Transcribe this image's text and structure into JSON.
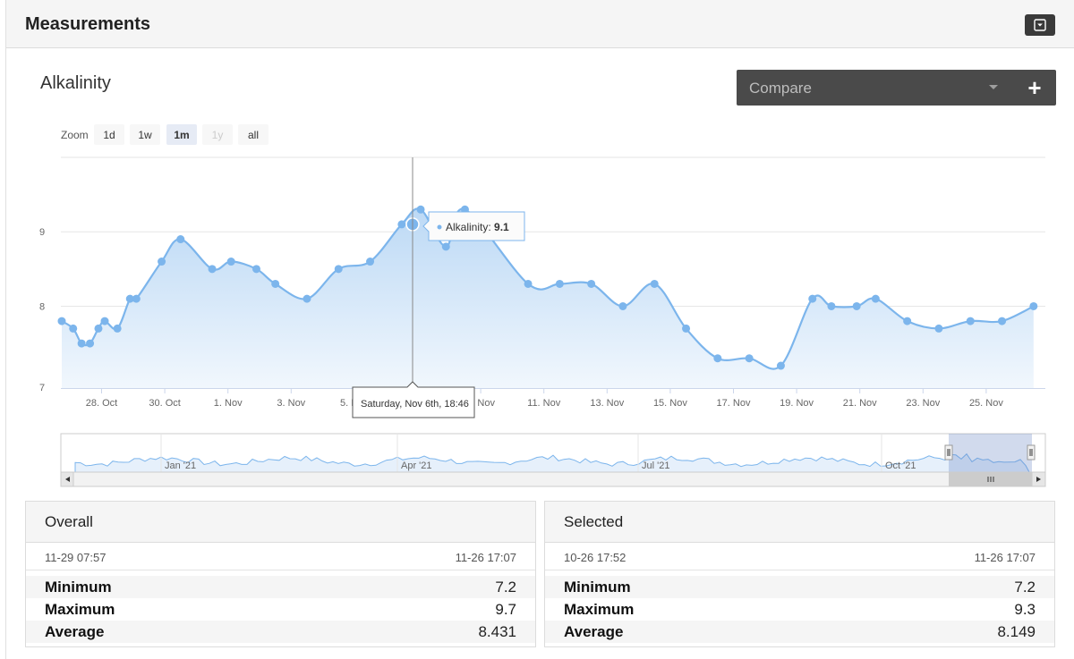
{
  "panel": {
    "title": "Measurements"
  },
  "chart_header": {
    "title": "Alkalinity",
    "compare_placeholder": "Compare"
  },
  "zoom": {
    "label": "Zoom",
    "buttons": [
      "1d",
      "1w",
      "1m",
      "1y",
      "all"
    ],
    "selected": "1m",
    "disabled": [
      "1y"
    ]
  },
  "tooltip": {
    "series": "Alkalinity",
    "value": "9.1",
    "date_label": "Saturday, Nov 6th, 18:46"
  },
  "navigator": {
    "labels": [
      "Jan '21",
      "Apr '21",
      "Jul '21",
      "Oct '21"
    ]
  },
  "colors": {
    "series": "#7cb5ec",
    "area_top": "#bcd9f5",
    "area_bottom": "#f1f7fd",
    "compare_bg": "#4a4a4a"
  },
  "chart_data": {
    "type": "area",
    "series_name": "Alkalinity",
    "ylim": [
      7,
      10
    ],
    "yticks": [
      7,
      8,
      9
    ],
    "grid": true,
    "xticks": [
      "28. Oct",
      "30. Oct",
      "1. Nov",
      "3. Nov",
      "5. Nov",
      "9. Nov",
      "11. Nov",
      "13. Nov",
      "15. Nov",
      "17. Nov",
      "19. Nov",
      "21. Nov",
      "23. Nov",
      "25. Nov"
    ],
    "points": [
      [
        "2021-10-26",
        7.8
      ],
      [
        "2021-10-27",
        7.7
      ],
      [
        "2021-10-27",
        7.5
      ],
      [
        "2021-10-27",
        7.5
      ],
      [
        "2021-10-27",
        7.7
      ],
      [
        "2021-10-28",
        7.8
      ],
      [
        "2021-10-28",
        7.7
      ],
      [
        "2021-10-28",
        8.1
      ],
      [
        "2021-10-29",
        8.1
      ],
      [
        "2021-10-29",
        8.6
      ],
      [
        "2021-10-30",
        8.9
      ],
      [
        "2021-10-31",
        8.5
      ],
      [
        "2021-11-01",
        8.6
      ],
      [
        "2021-11-01",
        8.5
      ],
      [
        "2021-11-02",
        8.3
      ],
      [
        "2021-11-03",
        8.1
      ],
      [
        "2021-11-04",
        8.5
      ],
      [
        "2021-11-05",
        8.6
      ],
      [
        "2021-11-06",
        9.1
      ],
      [
        "2021-11-07",
        9.3
      ],
      [
        "2021-11-07",
        8.8
      ],
      [
        "2021-11-08",
        9.3
      ],
      [
        "2021-11-10",
        8.3
      ],
      [
        "2021-11-11",
        8.3
      ],
      [
        "2021-11-12",
        8.3
      ],
      [
        "2021-11-13",
        8.0
      ],
      [
        "2021-11-14",
        8.3
      ],
      [
        "2021-11-15",
        7.7
      ],
      [
        "2021-11-16",
        7.3
      ],
      [
        "2021-11-17",
        7.3
      ],
      [
        "2021-11-18",
        7.2
      ],
      [
        "2021-11-19",
        8.1
      ],
      [
        "2021-11-20",
        8.0
      ],
      [
        "2021-11-20",
        8.0
      ],
      [
        "2021-11-21",
        8.1
      ],
      [
        "2021-11-22",
        7.8
      ],
      [
        "2021-11-23",
        7.7
      ],
      [
        "2021-11-24",
        7.8
      ],
      [
        "2021-11-25",
        7.8
      ],
      [
        "2021-11-26",
        8.0
      ]
    ]
  },
  "stats": {
    "overall": {
      "title": "Overall",
      "from": "11-29 07:57",
      "to": "11-26 17:07",
      "min_label": "Minimum",
      "min": "7.2",
      "max_label": "Maximum",
      "max": "9.7",
      "avg_label": "Average",
      "avg": "8.431"
    },
    "selected": {
      "title": "Selected",
      "from": "10-26 17:52",
      "to": "11-26 17:07",
      "min_label": "Minimum",
      "min": "7.2",
      "max_label": "Maximum",
      "max": "9.3",
      "avg_label": "Average",
      "avg": "8.149"
    }
  }
}
